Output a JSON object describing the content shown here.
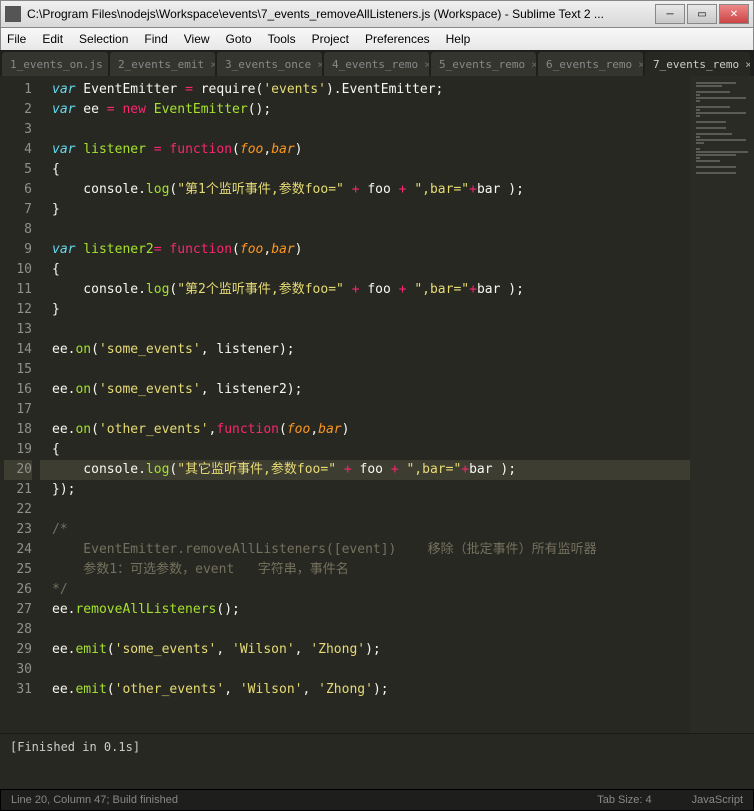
{
  "window": {
    "title": "C:\\Program Files\\nodejs\\Workspace\\events\\7_events_removeAllListeners.js (Workspace) - Sublime Text 2 ..."
  },
  "menu": {
    "file": "File",
    "edit": "Edit",
    "selection": "Selection",
    "find": "Find",
    "view": "View",
    "goto": "Goto",
    "tools": "Tools",
    "project": "Project",
    "preferences": "Preferences",
    "help": "Help"
  },
  "tabs": [
    {
      "label": "1_events_on.js"
    },
    {
      "label": "2_events_emit"
    },
    {
      "label": "3_events_once"
    },
    {
      "label": "4_events_remo"
    },
    {
      "label": "5_events_remo"
    },
    {
      "label": "6_events_remo"
    },
    {
      "label": "7_events_remo"
    }
  ],
  "lines": {
    "1": [
      [
        "kw",
        "var"
      ],
      [
        "",
        " EventEmitter "
      ],
      [
        "op",
        "="
      ],
      [
        "",
        " require("
      ],
      [
        "lit",
        "'events'"
      ],
      [
        "",
        ")."
      ],
      [
        "",
        "EventEmitter;"
      ]
    ],
    "2": [
      [
        "kw",
        "var"
      ],
      [
        "",
        " ee "
      ],
      [
        "op",
        "="
      ],
      [
        "",
        " "
      ],
      [
        "op",
        "new"
      ],
      [
        "",
        " "
      ],
      [
        "nm",
        "EventEmitter"
      ],
      [
        "",
        "();"
      ]
    ],
    "3": [
      [
        "",
        ""
      ]
    ],
    "4": [
      [
        "kw",
        "var"
      ],
      [
        "",
        " "
      ],
      [
        "nm",
        "listener"
      ],
      [
        "",
        " "
      ],
      [
        "op",
        "="
      ],
      [
        "",
        " "
      ],
      [
        "st",
        "function"
      ],
      [
        "",
        "("
      ],
      [
        "par",
        "foo"
      ],
      [
        "",
        ","
      ],
      [
        "par",
        "bar"
      ],
      [
        "",
        ")"
      ]
    ],
    "5": [
      [
        "",
        "{"
      ]
    ],
    "6": [
      [
        "",
        "    console."
      ],
      [
        "nm",
        "log"
      ],
      [
        "",
        "("
      ],
      [
        "lit",
        "\"第1个监听事件,参数foo=\""
      ],
      [
        "",
        " "
      ],
      [
        "op",
        "+"
      ],
      [
        "",
        " foo "
      ],
      [
        "op",
        "+"
      ],
      [
        "",
        " "
      ],
      [
        "lit",
        "\",bar=\""
      ],
      [
        "op",
        "+"
      ],
      [
        "",
        "bar );"
      ]
    ],
    "7": [
      [
        "",
        "}"
      ]
    ],
    "8": [
      [
        "",
        ""
      ]
    ],
    "9": [
      [
        "kw",
        "var"
      ],
      [
        "",
        " "
      ],
      [
        "nm",
        "listener2"
      ],
      [
        "op",
        "="
      ],
      [
        "",
        " "
      ],
      [
        "st",
        "function"
      ],
      [
        "",
        "("
      ],
      [
        "par",
        "foo"
      ],
      [
        "",
        ","
      ],
      [
        "par",
        "bar"
      ],
      [
        "",
        ")"
      ]
    ],
    "10": [
      [
        "",
        "{"
      ]
    ],
    "11": [
      [
        "",
        "    console."
      ],
      [
        "nm",
        "log"
      ],
      [
        "",
        "("
      ],
      [
        "lit",
        "\"第2个监听事件,参数foo=\""
      ],
      [
        "",
        " "
      ],
      [
        "op",
        "+"
      ],
      [
        "",
        " foo "
      ],
      [
        "op",
        "+"
      ],
      [
        "",
        " "
      ],
      [
        "lit",
        "\",bar=\""
      ],
      [
        "op",
        "+"
      ],
      [
        "",
        "bar );"
      ]
    ],
    "12": [
      [
        "",
        "}"
      ]
    ],
    "13": [
      [
        "",
        ""
      ]
    ],
    "14": [
      [
        "",
        "ee."
      ],
      [
        "nm",
        "on"
      ],
      [
        "",
        "("
      ],
      [
        "lit",
        "'some_events'"
      ],
      [
        "",
        ", listener);"
      ]
    ],
    "15": [
      [
        "",
        ""
      ]
    ],
    "16": [
      [
        "",
        "ee."
      ],
      [
        "nm",
        "on"
      ],
      [
        "",
        "("
      ],
      [
        "lit",
        "'some_events'"
      ],
      [
        "",
        ", listener2);"
      ]
    ],
    "17": [
      [
        "",
        ""
      ]
    ],
    "18": [
      [
        "",
        "ee."
      ],
      [
        "nm",
        "on"
      ],
      [
        "",
        "("
      ],
      [
        "lit",
        "'other_events'"
      ],
      [
        "",
        ","
      ],
      [
        "st",
        "function"
      ],
      [
        "",
        "("
      ],
      [
        "par",
        "foo"
      ],
      [
        "",
        ","
      ],
      [
        "par",
        "bar"
      ],
      [
        "",
        ")"
      ]
    ],
    "19": [
      [
        "",
        "{"
      ]
    ],
    "20": [
      [
        "",
        "    console."
      ],
      [
        "nm",
        "log"
      ],
      [
        "",
        "("
      ],
      [
        "lit",
        "\"其它监听事件,参数foo=\""
      ],
      [
        "",
        " "
      ],
      [
        "op",
        "+"
      ],
      [
        "",
        " foo "
      ],
      [
        "op",
        "+"
      ],
      [
        "",
        " "
      ],
      [
        "lit",
        "\",bar=\""
      ],
      [
        "op",
        "+"
      ],
      [
        "",
        "bar );"
      ]
    ],
    "21": [
      [
        "",
        "});"
      ]
    ],
    "22": [
      [
        "",
        ""
      ]
    ],
    "23": [
      [
        "cmnt",
        "/*"
      ]
    ],
    "24": [
      [
        "cmnt",
        "    EventEmitter.removeAllListeners([event])    移除（批定事件）所有监听器"
      ]
    ],
    "25": [
      [
        "cmnt",
        "    参数1：可选参数，event   字符串，事件名"
      ]
    ],
    "26": [
      [
        "cmnt",
        "*/"
      ]
    ],
    "27": [
      [
        "",
        "ee."
      ],
      [
        "nm",
        "removeAllListeners"
      ],
      [
        "",
        "();"
      ]
    ],
    "28": [
      [
        "",
        ""
      ]
    ],
    "29": [
      [
        "",
        "ee."
      ],
      [
        "nm",
        "emit"
      ],
      [
        "",
        "("
      ],
      [
        "lit",
        "'some_events'"
      ],
      [
        "",
        ", "
      ],
      [
        "lit",
        "'Wilson'"
      ],
      [
        "",
        ", "
      ],
      [
        "lit",
        "'Zhong'"
      ],
      [
        "",
        ");"
      ]
    ],
    "30": [
      [
        "",
        ""
      ]
    ],
    "31": [
      [
        "",
        "ee."
      ],
      [
        "nm",
        "emit"
      ],
      [
        "",
        "("
      ],
      [
        "lit",
        "'other_events'"
      ],
      [
        "",
        ", "
      ],
      [
        "lit",
        "'Wilson'"
      ],
      [
        "",
        ", "
      ],
      [
        "lit",
        "'Zhong'"
      ],
      [
        "",
        ");"
      ]
    ]
  },
  "activeLine": 20,
  "console": {
    "output": "[Finished in 0.1s]"
  },
  "status": {
    "left": "Line 20, Column 47; Build finished",
    "tabsize": "Tab Size: 4",
    "lang": "JavaScript"
  }
}
